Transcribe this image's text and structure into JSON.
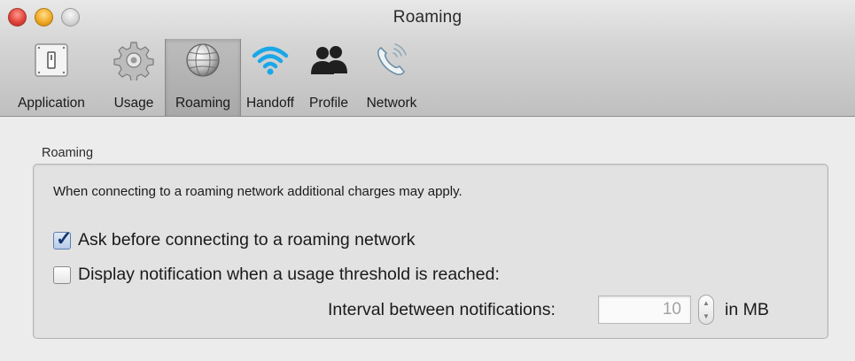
{
  "window": {
    "title": "Roaming"
  },
  "toolbar": {
    "items": [
      {
        "label": "Application",
        "icon": "switch-icon",
        "selected": false
      },
      {
        "label": "Usage",
        "icon": "gear-icon",
        "selected": false
      },
      {
        "label": "Roaming",
        "icon": "globe-icon",
        "selected": true
      },
      {
        "label": "Handoff",
        "icon": "wifi-icon",
        "selected": false
      },
      {
        "label": "Profile",
        "icon": "people-icon",
        "selected": false
      },
      {
        "label": "Network",
        "icon": "phone-signal-icon",
        "selected": false
      }
    ]
  },
  "roaming": {
    "section_title": "Roaming",
    "description": "When connecting to a roaming network additional charges may apply.",
    "ask_before_connecting": {
      "label": "Ask before connecting to a roaming network",
      "checked": true
    },
    "display_notification": {
      "label": "Display notification when a usage threshold is reached:",
      "checked": false
    },
    "interval_label": "Interval between notifications:",
    "interval_value": "10",
    "interval_unit": "in MB"
  },
  "colors": {
    "selected_tab": "#a8a8a8",
    "checkbox_checked": "#15356f",
    "wifi": "#1aa7e8"
  }
}
